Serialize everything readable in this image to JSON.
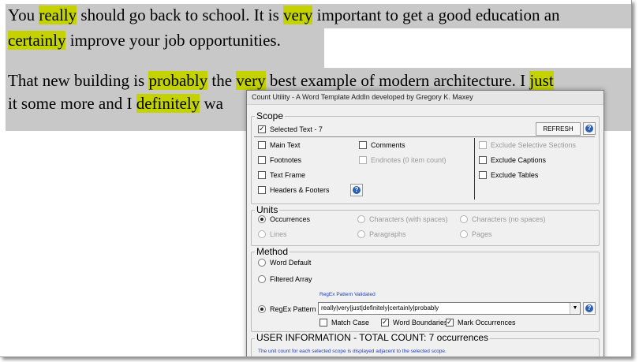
{
  "document": {
    "line1": {
      "s0": "You ",
      "h1": "really",
      "s1": " should go back to school. It is ",
      "h2": "very",
      "s2": " important to get a good education an"
    },
    "line2": {
      "h1": "certainly",
      "s1": " improve your job opportunities."
    },
    "line3": {
      "s0": "That new building is ",
      "h1": "probably",
      "s1": " the ",
      "h2": "very",
      "s2": " best example of modern architecture. I ",
      "h3": "just"
    },
    "line4": {
      "s0": "it some more and I ",
      "h1": "definitely",
      "s1": " wa"
    },
    "highlight_color": "#c4d300",
    "selection_color": "#c8c8c8"
  },
  "dialog": {
    "title": "Count Utility - A Word Template AddIn developed by Gregory K. Maxey",
    "scope": {
      "label": "Scope",
      "selected_text": "Selected Text - 7",
      "refresh": "REFRESH",
      "main_text": "Main Text",
      "comments": "Comments",
      "footnotes": "Footnotes",
      "endnotes": "Endnotes (0 item count)",
      "text_frame": "Text Frame",
      "headers_footers": "Headers & Footers",
      "exclude_selective": "Exclude Selective Sections",
      "exclude_captions": "Exclude Captions",
      "exclude_tables": "Exclude Tables"
    },
    "units": {
      "label": "Units",
      "occurrences": "Occurrences",
      "chars_spaces": "Characters (with spaces)",
      "chars_no_spaces": "Characters (no spaces)",
      "lines": "Lines",
      "paragraphs": "Paragraphs",
      "pages": "Pages"
    },
    "method": {
      "label": "Method",
      "word_default": "Word Default",
      "filtered_array": "Filtered Array",
      "regex_pattern": "RegEx Pattern",
      "regex_validated": "RegEx Pattern Validated",
      "pattern_value": "really|very|just|definitely|certainly|probably",
      "match_case": "Match Case",
      "word_boundaries": "Word Boundaries",
      "mark_occurrences": "Mark Occurrences"
    },
    "info": {
      "label": "USER INFORMATION - TOTAL COUNT: 7 occurrences",
      "note": "The unit count for each selected scope is displayed adjacent to the selected scope."
    }
  }
}
